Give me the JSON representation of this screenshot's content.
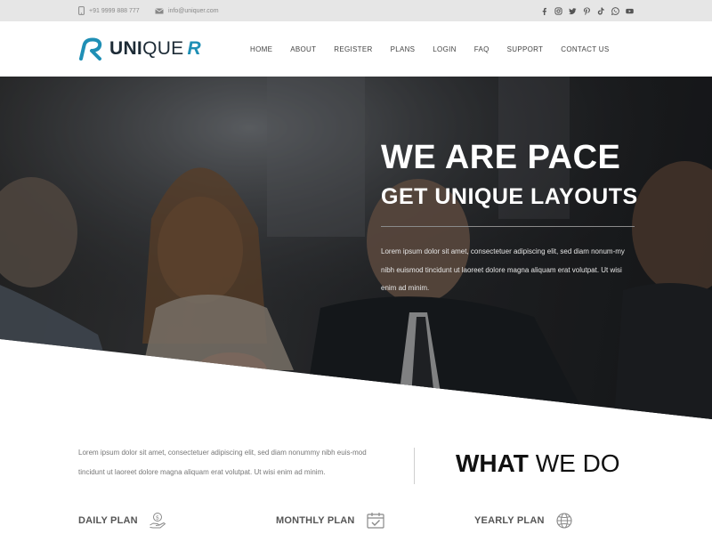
{
  "topbar": {
    "phone": "+91 9999 888 777",
    "email": "info@uniquer.com",
    "social_icons": [
      "facebook-icon",
      "instagram-icon",
      "twitter-icon",
      "pinterest-icon",
      "tiktok-icon",
      "whatsapp-icon",
      "youtube-icon"
    ]
  },
  "brand": {
    "name_bold": "UNI",
    "name_light": "QUE",
    "name_accent": "R",
    "accent_color": "#1f8fb5"
  },
  "nav": {
    "items": [
      "HOME",
      "ABOUT",
      "REGISTER",
      "PLANS",
      "LOGIN",
      "FAQ",
      "SUPPORT",
      "CONTACT US"
    ]
  },
  "hero": {
    "title": "WE ARE PACE",
    "subtitle": "GET UNIQUE LAYOUTS",
    "text": "Lorem ipsum dolor sit amet, consectetuer adipiscing elit, sed diam nonum-my nibh euismod tincidunt ut laoreet dolore magna aliquam erat volutpat. Ut wisi enim ad minim."
  },
  "what_we_do": {
    "intro": "Lorem ipsum dolor sit amet, consectetuer adipiscing elit, sed diam nonummy nibh euis-mod tincidunt ut laoreet dolore magna aliquam erat volutpat. Ut wisi enim ad minim.",
    "title_bold": "WHAT",
    "title_light": "WE DO"
  },
  "plans": [
    {
      "label": "DAILY PLAN",
      "icon": "money-hand-icon"
    },
    {
      "label": "MONTHLY PLAN",
      "icon": "calendar-check-icon"
    },
    {
      "label": "YEARLY PLAN",
      "icon": "globe-icon"
    }
  ]
}
